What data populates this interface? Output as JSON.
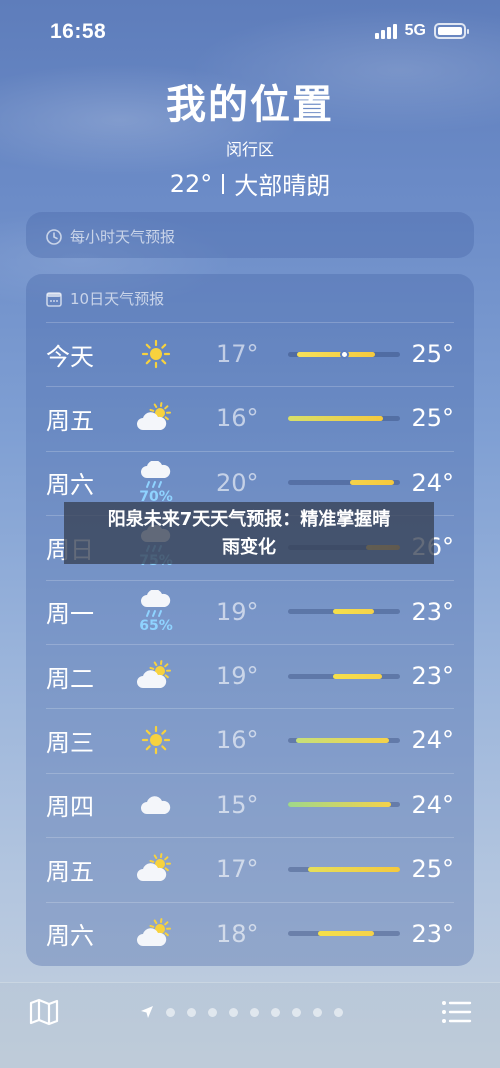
{
  "status_bar": {
    "time": "16:58",
    "network": "5G"
  },
  "header": {
    "location": "我的位置",
    "district": "闵行区",
    "current_temp": "22°",
    "condition": "大部晴朗"
  },
  "hourly_card": {
    "title": "每小时天气预报"
  },
  "daily_card": {
    "title": "10日天气预报",
    "rows": [
      {
        "day": "今天",
        "icon": "sun-icon",
        "precip": "",
        "low": "17°",
        "high": "25°",
        "range_start": 0.08,
        "range_end": 0.78,
        "current": 0.5,
        "color_from": "#f7e15a",
        "color_to": "#f5c93e"
      },
      {
        "day": "周五",
        "icon": "partly-cloudy-icon",
        "precip": "",
        "low": "16°",
        "high": "25°",
        "range_start": 0.0,
        "range_end": 0.85,
        "color_from": "#d7e06a",
        "color_to": "#f5c93e"
      },
      {
        "day": "周六",
        "icon": "rain-icon",
        "precip": "70%",
        "low": "20°",
        "high": "24°",
        "range_start": 0.55,
        "range_end": 0.95,
        "color_from": "#f5d24a",
        "color_to": "#f5c93e"
      },
      {
        "day": "周日",
        "icon": "rain-icon",
        "precip": "75%",
        "low": "",
        "high": "26°",
        "range_start": 0.7,
        "range_end": 1.0,
        "color_from": "#f5c04a",
        "color_to": "#f2ad3a"
      },
      {
        "day": "周一",
        "icon": "rain-icon",
        "precip": "65%",
        "low": "19°",
        "high": "23°",
        "range_start": 0.4,
        "range_end": 0.77,
        "color_from": "#f5e04a",
        "color_to": "#f5d24a"
      },
      {
        "day": "周二",
        "icon": "partly-cloudy-icon",
        "precip": "",
        "low": "19°",
        "high": "23°",
        "range_start": 0.4,
        "range_end": 0.84,
        "color_from": "#f5e04a",
        "color_to": "#f5d24a"
      },
      {
        "day": "周三",
        "icon": "sun-icon",
        "precip": "",
        "low": "16°",
        "high": "24°",
        "range_start": 0.07,
        "range_end": 0.9,
        "color_from": "#c6e07a",
        "color_to": "#f5d24a"
      },
      {
        "day": "周四",
        "icon": "cloud-icon",
        "precip": "",
        "low": "15°",
        "high": "24°",
        "range_start": 0.0,
        "range_end": 0.92,
        "color_from": "#9fd88a",
        "color_to": "#f5d24a"
      },
      {
        "day": "周五",
        "icon": "partly-cloudy-icon",
        "precip": "",
        "low": "17°",
        "high": "25°",
        "range_start": 0.18,
        "range_end": 1.0,
        "color_from": "#e6df5a",
        "color_to": "#f5c93e"
      },
      {
        "day": "周六",
        "icon": "partly-cloudy-icon",
        "precip": "",
        "low": "18°",
        "high": "23°",
        "range_start": 0.27,
        "range_end": 0.77,
        "color_from": "#f5e04a",
        "color_to": "#f5d24a"
      }
    ]
  },
  "banner": {
    "line1": "阳泉未来7天天气预报：精准掌握晴",
    "line2": "雨变化"
  },
  "bottom_bar": {
    "map_icon": "map-icon",
    "list_icon": "list-icon",
    "page_count": 9
  }
}
